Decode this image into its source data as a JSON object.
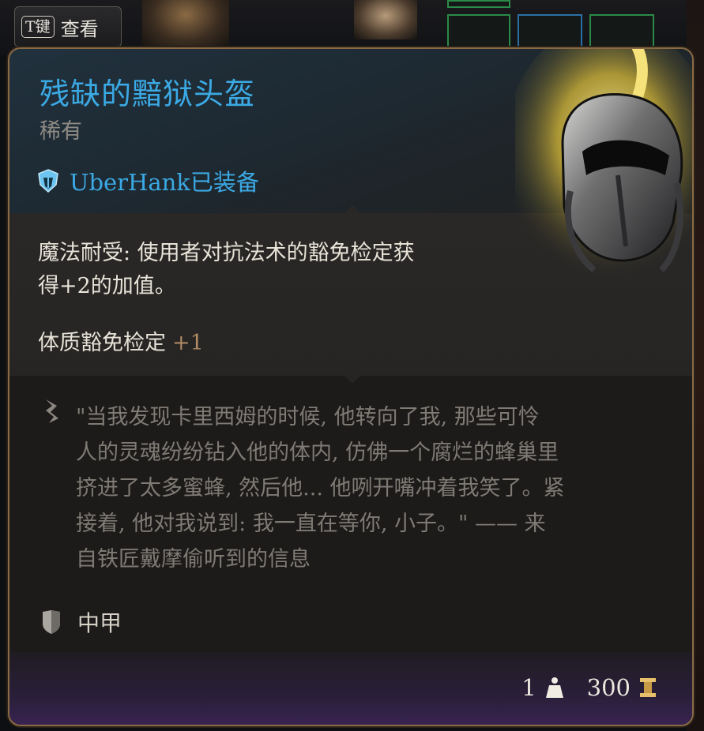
{
  "hotkey": {
    "key": "T键",
    "label": "查看"
  },
  "item": {
    "name": "残缺的黯狱头盔",
    "rarity": "稀有",
    "equipped_by": "UberHank已装备"
  },
  "stats": {
    "description_line1": "魔法耐受: 使用者对抗法术的豁免检定获",
    "description_line2": "得+2的加值。",
    "bonus_label": "体质豁免检定",
    "bonus_value": "+1"
  },
  "lore": {
    "line1": "\"当我发现卡里西姆的时候, 他转向了我, 那些可怜",
    "line2": "人的灵魂纷纷钻入他的体内, 仿佛一个腐烂的蜂巢里",
    "line3": "挤进了太多蜜蜂, 然后他... 他咧开嘴冲着我笑了。紧",
    "line4": "接着, 他对我说到: 我一直在等你, 小子。\" —— 来",
    "line5": "自铁匠戴摩偷听到的信息"
  },
  "armor_type": "中甲",
  "footer": {
    "weight": "1",
    "value": "300"
  },
  "icons": {
    "equipped": "helmet-badge-icon",
    "lore": "quill-icon",
    "armor": "shield-icon",
    "weight": "weight-icon",
    "gold": "gold-coin-icon"
  },
  "colors": {
    "title": "#3ba9e4",
    "border": "#8a6a45",
    "bonus": "#b08a66"
  }
}
